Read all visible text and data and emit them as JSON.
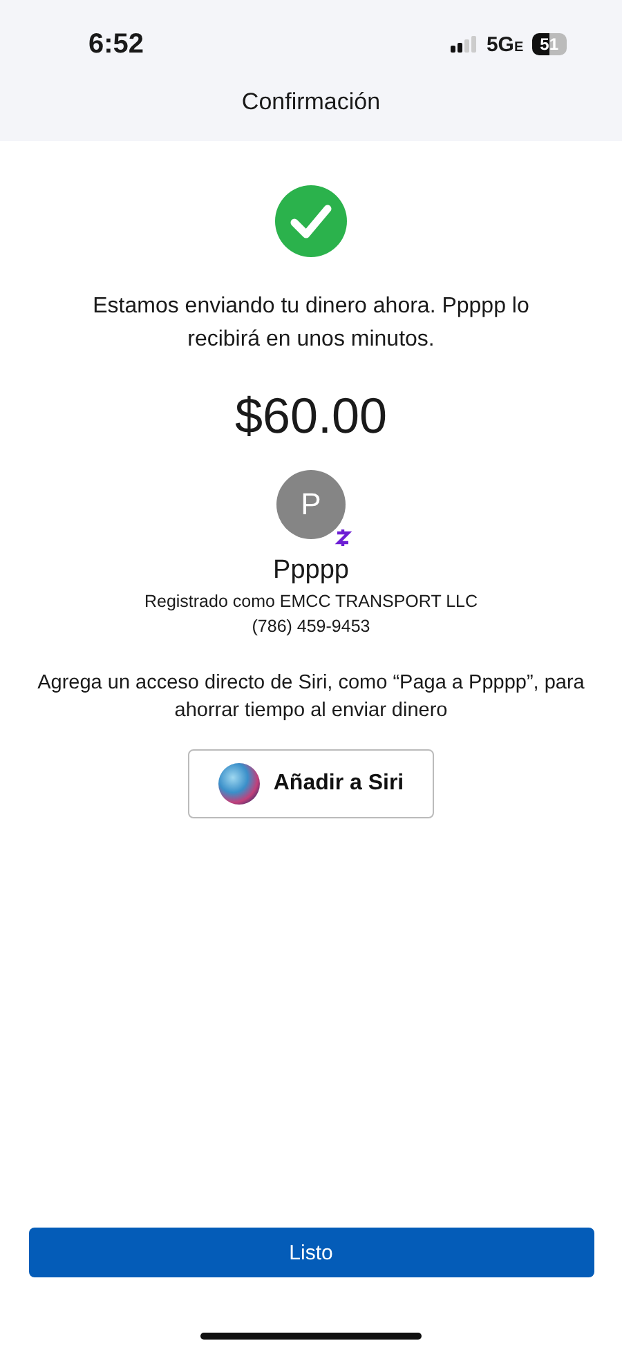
{
  "status_bar": {
    "time": "6:52",
    "network": "5G",
    "network_suffix": "E",
    "battery": "51"
  },
  "header": {
    "title": "Confirmación"
  },
  "message": "Estamos enviando tu dinero ahora. Ppppp lo recibirá en unos minutos.",
  "amount": "$60.00",
  "recipient": {
    "initial": "P",
    "name": "Ppppp",
    "registered": "Registrado como EMCC TRANSPORT LLC",
    "phone": "(786) 459-9453"
  },
  "siri_hint": "Agrega un acceso directo de Siri, como “Paga a Ppppp”, para ahorrar tiempo al enviar dinero",
  "siri_button": "Añadir a Siri",
  "done_button": "Listo"
}
